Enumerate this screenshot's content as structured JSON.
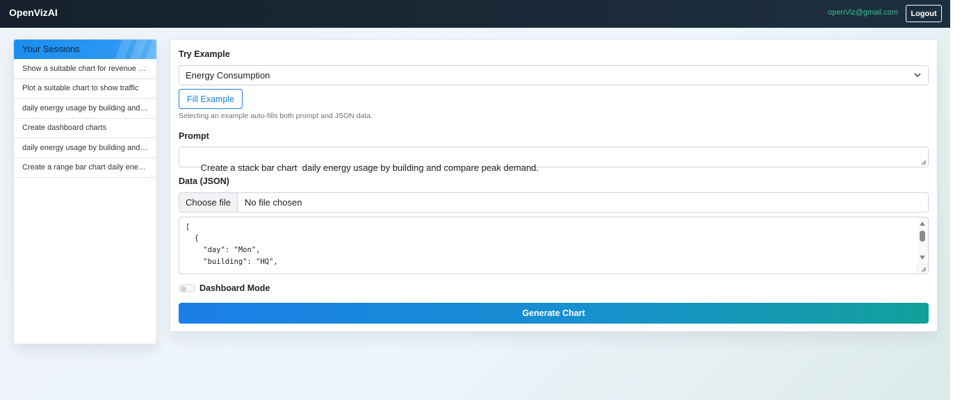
{
  "navbar": {
    "brand": "OpenVizAI",
    "email": "openViz@gmail.com",
    "logout_label": "Logout"
  },
  "sidebar": {
    "title": "Your Sessions",
    "items": [
      {
        "label": "Show a suitable chart for revenue by region"
      },
      {
        "label": "Plot a suitable chart to show traffic"
      },
      {
        "label": "daily energy usage by building and compare"
      },
      {
        "label": "Create dashboard charts"
      },
      {
        "label": "daily energy usage by building and compare"
      },
      {
        "label": "Create a range bar chart daily energy"
      }
    ]
  },
  "form": {
    "try_example_label": "Try Example",
    "example_selected": "Energy Consumption",
    "fill_example_label": "Fill Example",
    "help_text": "Selecting an example auto-fills both prompt and JSON data.",
    "prompt_label": "Prompt",
    "prompt_value": "Create a stack bar chart  daily energy usage by building and compare peak demand.",
    "data_label": "Data (JSON)",
    "choose_file_label": "Choose file",
    "file_status": "No file chosen",
    "json_lines": [
      "[",
      "  {",
      "    \"day\": \"Mon\",",
      "    \"building\": \"HQ\","
    ],
    "dashboard_mode_label": "Dashboard Mode",
    "dashboard_mode_on": false,
    "generate_label": "Generate Chart"
  },
  "colors": {
    "navbar_bg": "#15202c",
    "accent_blue": "#1a7fe0",
    "email_green": "#3fbf9a",
    "generate_gradient_end": "#12a09a"
  }
}
